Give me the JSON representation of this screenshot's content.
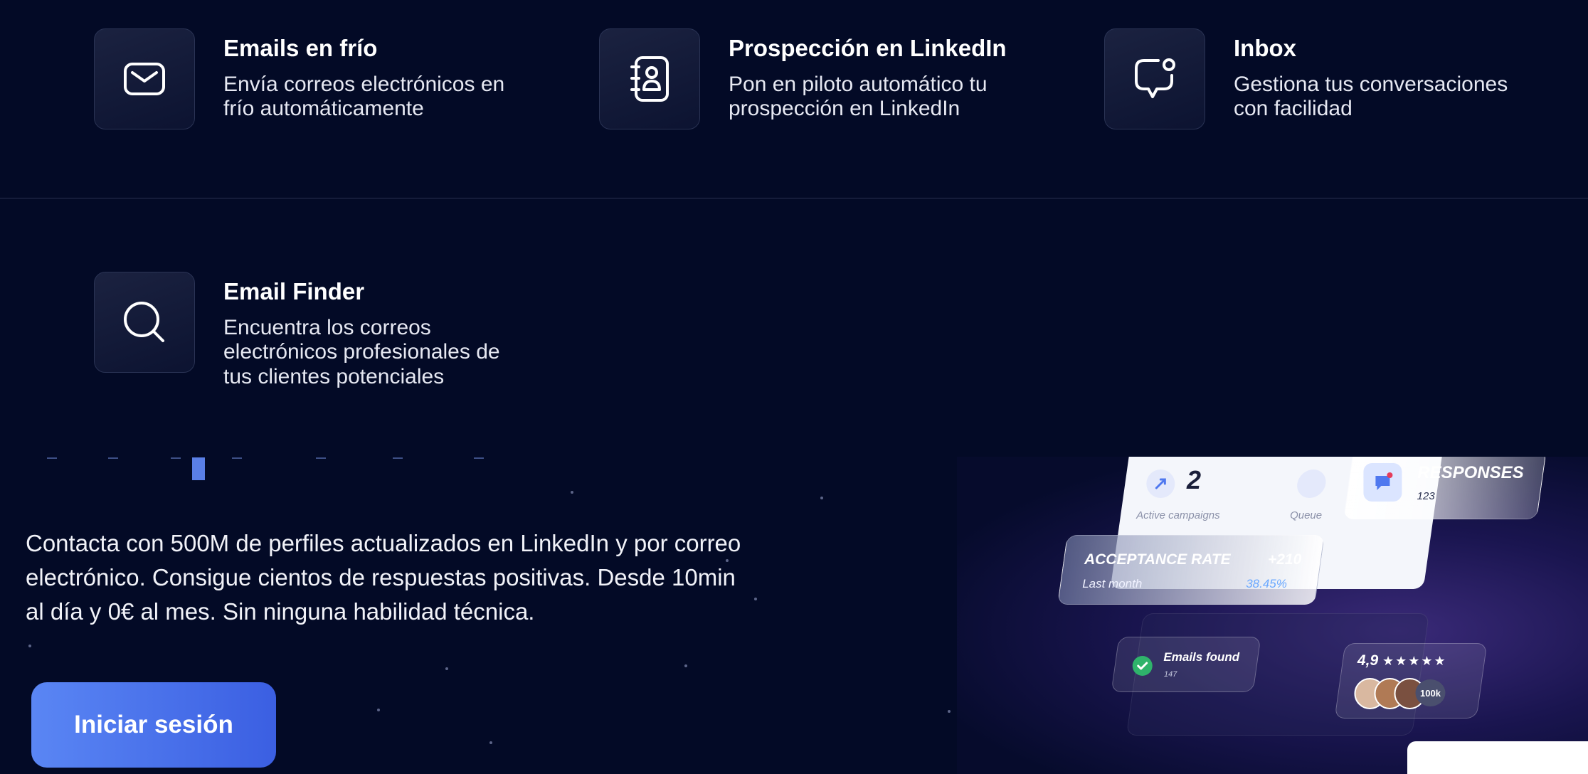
{
  "features": [
    {
      "title": "Emails en frío",
      "desc_line1": "Envía correos electrónicos en",
      "desc_line2": "frío automáticamente",
      "icon": "envelope-icon"
    },
    {
      "title": "Prospección en LinkedIn",
      "desc_line1": "Pon en piloto automático tu",
      "desc_line2": "prospección en LinkedIn",
      "icon": "contact-book-icon"
    },
    {
      "title": "Inbox",
      "desc_line1": "Gestiona tus conversaciones",
      "desc_line2": "con facilidad",
      "icon": "chat-bubble-icon"
    },
    {
      "title": "Email Finder",
      "desc_line1": "Encuentra los correos",
      "desc_line2": "electrónicos profesionales de",
      "desc_line3": "tus clientes potenciales",
      "icon": "search-icon"
    }
  ],
  "hero": {
    "line1": "Contacta con 500M de perfiles actualizados en LinkedIn y por correo",
    "line2": "electrónico. Consigue cientos de respuestas positivas. Desde 10min",
    "line3": "al día y 0€ al mes. Sin ninguna habilidad técnica.",
    "cta_label": "Iniciar sesión"
  },
  "mockup": {
    "active_count": "2",
    "active_label": "Active campaigns",
    "queue_label": "Queue",
    "responses_title": "RESPONSES",
    "responses_value": "123",
    "acceptance_title": "ACCEPTANCE RATE",
    "acceptance_delta": "+210",
    "acceptance_period": "Last month",
    "acceptance_pct": "38.45%",
    "emails_found_label": "Emails found",
    "emails_found_value": "147",
    "rating": "4,9",
    "stars": "★★★★★",
    "reviews": "100k",
    "colors": {
      "accent": "#4f78ef",
      "green": "#2fb36b",
      "pct": "#6aa8ff"
    }
  }
}
